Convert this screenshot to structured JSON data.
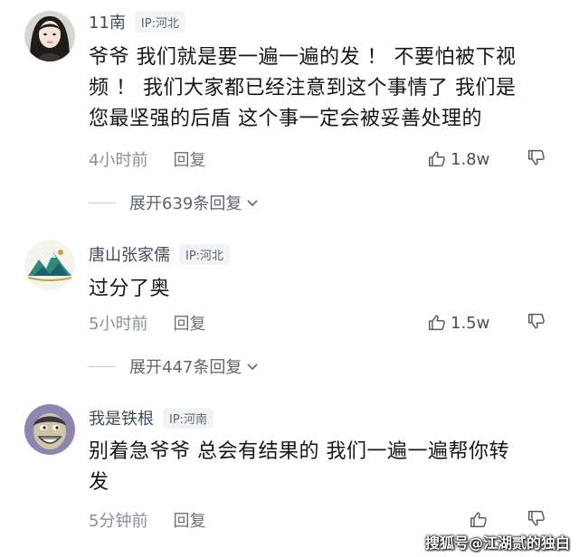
{
  "comments": [
    {
      "username": "11南",
      "ip_label": "IP:河北",
      "text": "爷爷 我们就是要一遍一遍的发 ！ 不要怕被下视\n频 ！ 我们大家都已经注意到这个事情了 我们是\n您最坚强的后盾 这个事一定会被妥善处理的",
      "time": "4小时前",
      "reply_label": "回复",
      "like_count": "1.8w",
      "expand_label": "展开639条回复"
    },
    {
      "username": "唐山张家儒",
      "ip_label": "IP:河北",
      "text": "过分了奥",
      "time": "5小时前",
      "reply_label": "回复",
      "like_count": "1.5w",
      "expand_label": "展开447条回复"
    },
    {
      "username": "我是铁根",
      "ip_label": "IP:河南",
      "text": "别着急爷爷 总会有结果的 我们一遍一遍帮你转\n发",
      "time": "5分钟前",
      "reply_label": "回复"
    }
  ],
  "watermark": "搜狐号@江湖贰的独白",
  "icons": {
    "like": "thumbs-up-icon",
    "dislike": "thumbs-down-icon",
    "expand": "chevron-down-icon"
  },
  "colors": {
    "username": "#3f4a5a",
    "meta": "#8a8f99",
    "badge_bg": "#f2f3f5"
  }
}
